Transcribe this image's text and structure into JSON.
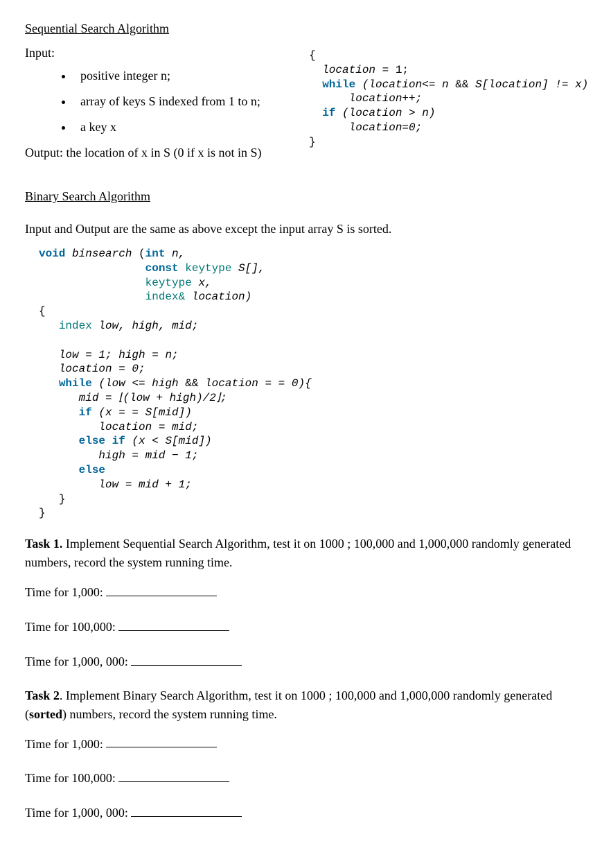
{
  "seqsearch": {
    "title": "Sequential Search Algorithm",
    "input_label": "Input:",
    "inputs": [
      "positive integer n;",
      "array of keys S indexed from 1 to n;",
      "a key x"
    ],
    "output": "Output: the location of x in S (0 if x is not in S)",
    "code": {
      "l1": "{",
      "l2a": "location",
      "l2b": " = 1;",
      "l3a": "while",
      "l3b": " (location<= n ",
      "l3c": "&&",
      "l3d": " S[location] != x)",
      "l4": "location++;",
      "l5a": "if",
      "l5b": " (location > n)",
      "l6": "location=0;",
      "l7": "}"
    }
  },
  "binsearch": {
    "title": "Binary Search Algorithm",
    "desc": "Input and Output are the same as above except the input array S is sorted.",
    "code": {
      "sig_void": "void",
      "sig_name": " binsearch ",
      "sig_open": "(",
      "sig_int": "int",
      "sig_n": " n,",
      "p2_const": "const",
      "p2_keytype": " keytype",
      "p2_rest": " S[],",
      "p3_keytype": "keytype",
      "p3_rest": " x,",
      "p4_index": "index&",
      "p4_rest": " location)",
      "lbrace": "{",
      "decl_index": "index",
      "decl_rest": " low, high, mid;",
      "init": "low = 1; high = n;",
      "loc0": "location = 0;",
      "while_kw": "while",
      "while_cond": " (low <= high ",
      "while_and": "&&",
      "while_rest": " location = = 0){",
      "mid": "mid = ⌊(low + high)/2⌋;",
      "if_kw": "if",
      "if_cond": " (x = = S[mid])",
      "if_body": "location = mid;",
      "elseif_kw": "else if",
      "elseif_cond": " (x < S[mid])",
      "elseif_body": "high = mid − 1;",
      "else_kw": "else",
      "else_body": "low = mid + 1;",
      "rbrace1": "}",
      "rbrace2": "}"
    }
  },
  "task1": {
    "label": "Task 1.",
    "desc": " Implement Sequential Search Algorithm, test it on 1000 ; 100,000 and 1,000,000 randomly generated numbers, record the system running time.",
    "time1": "Time for 1,000:",
    "time2": "Time for 100,000:",
    "time3": "Time for 1,000, 000:"
  },
  "task2": {
    "label": "Task 2",
    "desc": ". Implement Binary Search Algorithm, test it on 1000 ; 100,000 and 1,000,000 randomly generated (",
    "sorted": "sorted",
    "desc2": ") numbers, record the system running time.",
    "time1": "Time for 1,000:",
    "time2": "Time for 100,000:",
    "time3": "Time for 1,000, 000:"
  }
}
